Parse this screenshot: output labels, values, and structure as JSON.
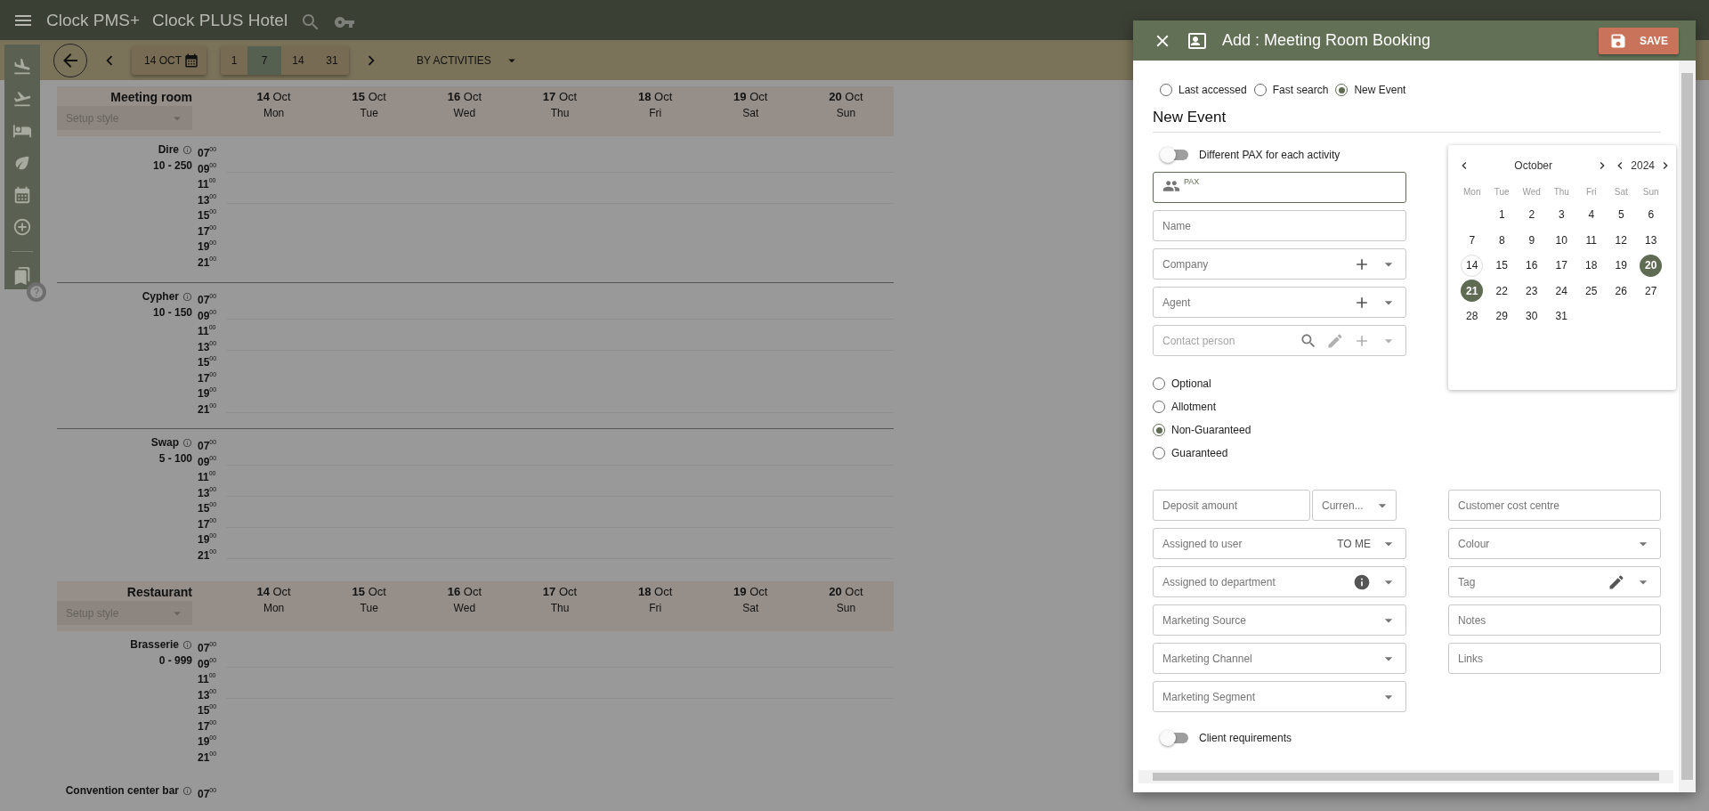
{
  "app_bar": {
    "product": "Clock PMS+",
    "hotel": "Clock PLUS Hotel"
  },
  "toolbar": {
    "date": "14 OCT",
    "view": "BY ACTIVITIES",
    "ranges": [
      {
        "label": "1",
        "selected": false
      },
      {
        "label": "7",
        "selected": true
      },
      {
        "label": "14",
        "selected": false
      },
      {
        "label": "31",
        "selected": false
      }
    ]
  },
  "groups": [
    {
      "name": "Meeting room",
      "setup_style": {
        "placeholder": "Setup style"
      },
      "days": [
        {
          "date": "**14** Oct",
          "weekday": "Mon"
        },
        {
          "date": "**15** Oct",
          "weekday": "Tue"
        },
        {
          "date": "**16** Oct",
          "weekday": "Wed"
        },
        {
          "date": "**17** Oct",
          "weekday": "Thu"
        },
        {
          "date": "**18** Oct",
          "weekday": "Fri"
        },
        {
          "date": "**19** Oct",
          "weekday": "Sat"
        },
        {
          "date": "**20** Oct",
          "weekday": "Sun"
        }
      ],
      "rooms": [
        {
          "name": "Dire",
          "capacity": "10 - 250",
          "times": [
            "07$^{00}$",
            "09$^{00}$",
            "11$^{00}$",
            "13$^{00}$",
            "15$^{00}$",
            "17$^{00}$",
            "19$^{00}$",
            "21$^{00}$"
          ]
        },
        {
          "name": "Cypher",
          "capacity": "10 - 150",
          "times": [
            "07$^{00}$",
            "09$^{00}$",
            "11$^{00}$",
            "13$^{00}$",
            "15$^{00}$",
            "17$^{00}$",
            "19$^{00}$",
            "21$^{00}$"
          ]
        },
        {
          "name": "Swap",
          "capacity": "5 - 100",
          "times": [
            "07$^{00}$",
            "09$^{00}$",
            "11$^{00}$",
            "13$^{00}$",
            "15$^{00}$",
            "17$^{00}$",
            "19$^{00}$",
            "21$^{00}$"
          ]
        }
      ]
    },
    {
      "name": "Restaurant",
      "setup_style": {
        "placeholder": "Setup style"
      },
      "days": [
        {
          "date": "**14** Oct",
          "weekday": "Mon"
        },
        {
          "date": "**15** Oct",
          "weekday": "Tue"
        },
        {
          "date": "**16** Oct",
          "weekday": "Wed"
        },
        {
          "date": "**17** Oct",
          "weekday": "Thu"
        },
        {
          "date": "**18** Oct",
          "weekday": "Fri"
        },
        {
          "date": "**19** Oct",
          "weekday": "Sat"
        },
        {
          "date": "**20** Oct",
          "weekday": "Sun"
        }
      ],
      "rooms": [
        {
          "name": "Brasserie",
          "capacity": "0 - 999",
          "times": [
            "07$^{00}$",
            "09$^{00}$",
            "11$^{00}$",
            "13$^{00}$",
            "15$^{00}$",
            "17$^{00}$",
            "19$^{00}$",
            "21$^{00}$"
          ]
        },
        {
          "name": "Convention center bar",
          "times": [
            "07$^{00}$"
          ]
        }
      ]
    }
  ],
  "dialog": {
    "title": "Add : Meeting Room Booking",
    "save_label": "SAVE",
    "search_modes": [
      {
        "label": "Last accessed",
        "selected": false
      },
      {
        "label": "Fast search",
        "selected": false
      },
      {
        "label": "New Event",
        "selected": true
      }
    ],
    "heading": "New Event",
    "pax_toggle": {
      "label": "Different PAX for each activity",
      "on": false
    },
    "pax_field": {
      "label": "PAX"
    },
    "fields": [
      {
        "kind": "text",
        "placeholder": "Name"
      },
      {
        "kind": "add-select",
        "placeholder": "Company"
      },
      {
        "kind": "add-select",
        "placeholder": "Agent"
      },
      {
        "kind": "contact",
        "placeholder": "Contact person"
      }
    ],
    "statuses": [
      {
        "label": "Optional",
        "selected": false
      },
      {
        "label": "Allotment",
        "selected": false
      },
      {
        "label": "Non-Guaranteed",
        "selected": true
      },
      {
        "label": "Guaranteed",
        "selected": false
      }
    ],
    "calendar": {
      "month": "October",
      "year": "2024",
      "weekdays": [
        "Mon",
        "Tue",
        "Wed",
        "Thu",
        "Fri",
        "Sat",
        "Sun"
      ],
      "weeks": [
        [
          {
            "day": "1",
            "selected": false,
            "today": false
          },
          {
            "day": "2",
            "selected": false,
            "today": false
          },
          {
            "day": "3",
            "selected": false,
            "today": false
          },
          {
            "day": "4",
            "selected": false,
            "today": false
          },
          {
            "day": "5",
            "selected": false,
            "today": false
          },
          {
            "day": "6",
            "selected": false,
            "today": false
          }
        ],
        [
          {
            "day": "7",
            "selected": false,
            "today": false
          },
          {
            "day": "8",
            "selected": false,
            "today": false
          },
          {
            "day": "9",
            "selected": false,
            "today": false
          },
          {
            "day": "10",
            "selected": false,
            "today": false
          },
          {
            "day": "11",
            "selected": false,
            "today": false
          },
          {
            "day": "12",
            "selected": false,
            "today": false
          },
          {
            "day": "13",
            "selected": false,
            "today": false
          }
        ],
        [
          {
            "day": "14",
            "selected": false,
            "today": true
          },
          {
            "day": "15",
            "selected": false,
            "today": false
          },
          {
            "day": "16",
            "selected": false,
            "today": false
          },
          {
            "day": "17",
            "selected": false,
            "today": false
          },
          {
            "day": "18",
            "selected": false,
            "today": false
          },
          {
            "day": "19",
            "selected": false,
            "today": false
          },
          {
            "day": "20",
            "selected": true,
            "today": false
          }
        ],
        [
          {
            "day": "21",
            "selected": true,
            "today": false
          },
          {
            "day": "22",
            "selected": false,
            "today": false
          },
          {
            "day": "23",
            "selected": false,
            "today": false
          },
          {
            "day": "24",
            "selected": false,
            "today": false
          },
          {
            "day": "25",
            "selected": false,
            "today": false
          },
          {
            "day": "26",
            "selected": false,
            "today": false
          },
          {
            "day": "27",
            "selected": false,
            "today": false
          }
        ],
        [
          {
            "day": "28",
            "selected": false,
            "today": false
          },
          {
            "day": "29",
            "selected": false,
            "today": false
          },
          {
            "day": "30",
            "selected": false,
            "today": false
          },
          {
            "day": "31",
            "selected": false,
            "today": false
          }
        ]
      ]
    },
    "details_left": [
      {
        "kind": "deposit",
        "placeholder": "Deposit amount",
        "select_placeholder": "Curren..."
      },
      {
        "kind": "value-select",
        "placeholder": "Assigned to user",
        "value": "TO ME"
      },
      {
        "kind": "info-select",
        "placeholder": "Assigned to department"
      },
      {
        "kind": "select",
        "placeholder": "Marketing Source"
      },
      {
        "kind": "select",
        "placeholder": "Marketing Channel"
      },
      {
        "kind": "select",
        "placeholder": "Marketing Segment"
      }
    ],
    "details_right": [
      {
        "kind": "text",
        "placeholder": "Customer cost centre"
      },
      {
        "kind": "select",
        "placeholder": "Colour"
      },
      {
        "kind": "edit-select",
        "placeholder": "Tag"
      },
      {
        "kind": "text",
        "placeholder": "Notes"
      },
      {
        "kind": "text",
        "placeholder": "Links"
      }
    ],
    "client_toggle": {
      "label": "Client requirements",
      "on": false
    }
  }
}
